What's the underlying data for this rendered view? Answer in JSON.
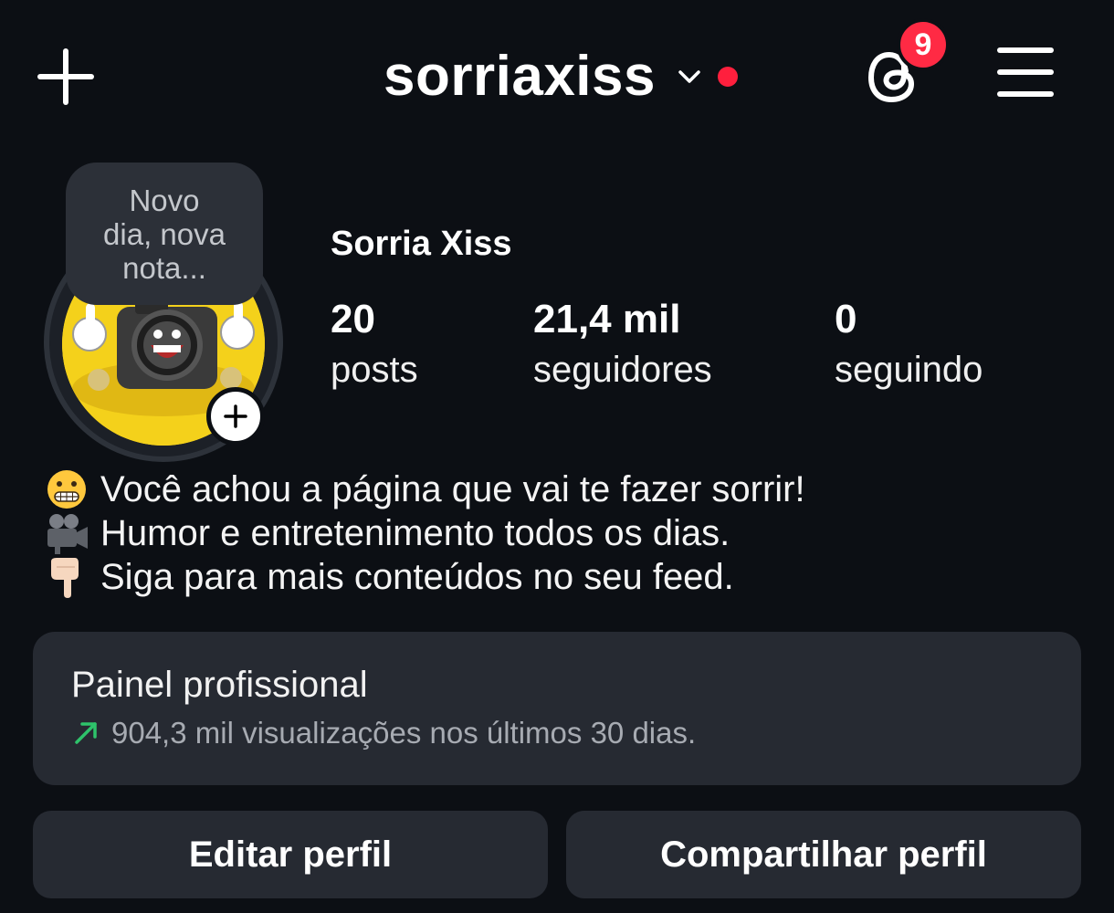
{
  "header": {
    "username": "sorriaxiss",
    "threads_badge_count": "9",
    "icons": [
      "plus-icon",
      "chevron-down-icon",
      "threads-icon",
      "hamburger-menu-icon"
    ],
    "colors": {
      "background": "#0c0f14",
      "notification_red": "#ff2a44",
      "trend_green": "#2ec36b"
    }
  },
  "profile": {
    "note": "Novo\ndia, nova\nnota...",
    "display_name": "Sorria Xiss",
    "stats": [
      {
        "value": "20",
        "label": "posts"
      },
      {
        "value": "21,4 mil",
        "label": "seguidores"
      },
      {
        "value": "0",
        "label": "seguindo"
      }
    ],
    "bio": [
      {
        "emoji": "grimacing-face",
        "text": "Você achou a página que vai te fazer sorrir!"
      },
      {
        "emoji": "movie-camera",
        "text": "Humor e entretenimento todos os dias."
      },
      {
        "emoji": "pointing-down-hand",
        "text": "Siga para mais conteúdos no seu feed."
      }
    ]
  },
  "professional_panel": {
    "title": "Painel profissional",
    "subtitle": "904,3 mil visualizações nos últimos 30 dias."
  },
  "actions": {
    "edit_profile": "Editar perfil",
    "share_profile": "Compartilhar perfil"
  }
}
